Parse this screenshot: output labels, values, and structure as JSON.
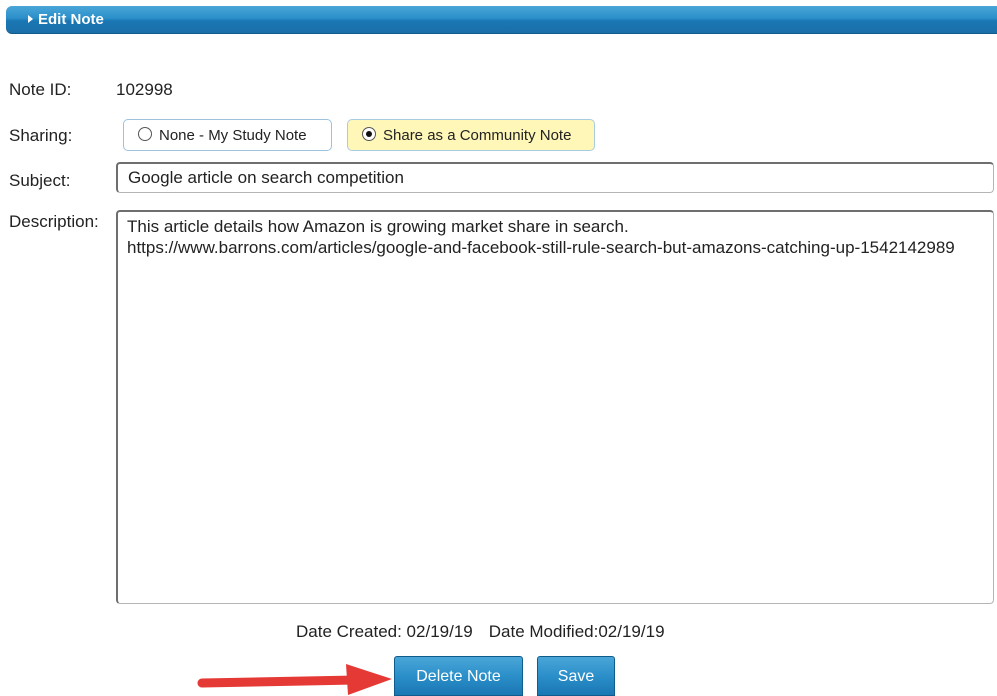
{
  "header": {
    "title": "Edit Note"
  },
  "fields": {
    "note_id_label": "Note ID:",
    "note_id_value": "102998",
    "sharing_label": "Sharing:",
    "sharing_options": [
      {
        "label": "None - My Study Note",
        "selected": false
      },
      {
        "label": "Share as a Community Note",
        "selected": true
      }
    ],
    "subject_label": "Subject:",
    "subject_value": "Google article on search competition",
    "description_label": "Description:",
    "description_value": "This article details how Amazon is growing market share in search.\nhttps://www.barrons.com/articles/google-and-facebook-still-rule-search-but-amazons-catching-up-1542142989"
  },
  "dates": {
    "created": "Date Created: 02/19/19",
    "modified": "Date Modified:02/19/19"
  },
  "buttons": {
    "delete": "Delete Note",
    "save": "Save"
  },
  "colors": {
    "header_blue": "#2b8fc9",
    "selected_option_bg": "#fff7b8",
    "annotation_arrow": "#e53935"
  }
}
